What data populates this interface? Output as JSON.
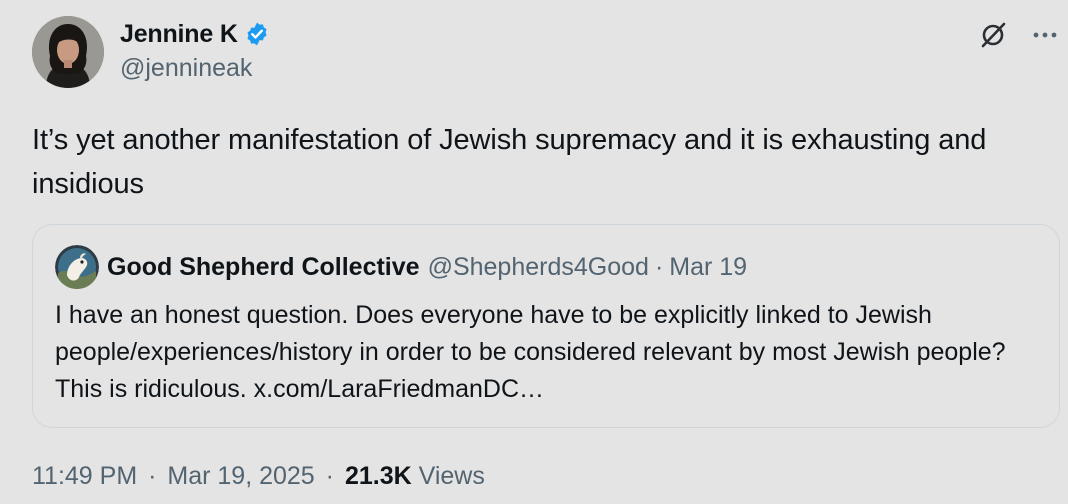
{
  "author": {
    "name": "Jennine K",
    "handle": "@jennineak",
    "avatar_icon": "profile-photo"
  },
  "icons": {
    "verified": "verified-badge-icon",
    "grok": "grok-icon",
    "more": "more-options-icon"
  },
  "colors": {
    "verified_blue": "#1d9bf0",
    "secondary_text": "#536471",
    "border": "#cfd6db"
  },
  "tweet": {
    "text": "It’s yet another manifestation of Jewish supremacy and it is exhausting and insidious"
  },
  "quote": {
    "name": "Good Shepherd Collective",
    "handle": "@Shepherds4Good",
    "separator": "·",
    "date": "Mar 19",
    "text": "I have an honest question. Does everyone have to be explicitly linked to Jewish people/experiences/history in order to be considered relevant by most Jewish people? This is ridiculous. x.com/LaraFriedmanDC…"
  },
  "meta": {
    "time": "11:49 PM",
    "separator1": "·",
    "date": "Mar 19, 2025",
    "separator2": "·",
    "views_count": "21.3K",
    "views_label": "Views"
  }
}
